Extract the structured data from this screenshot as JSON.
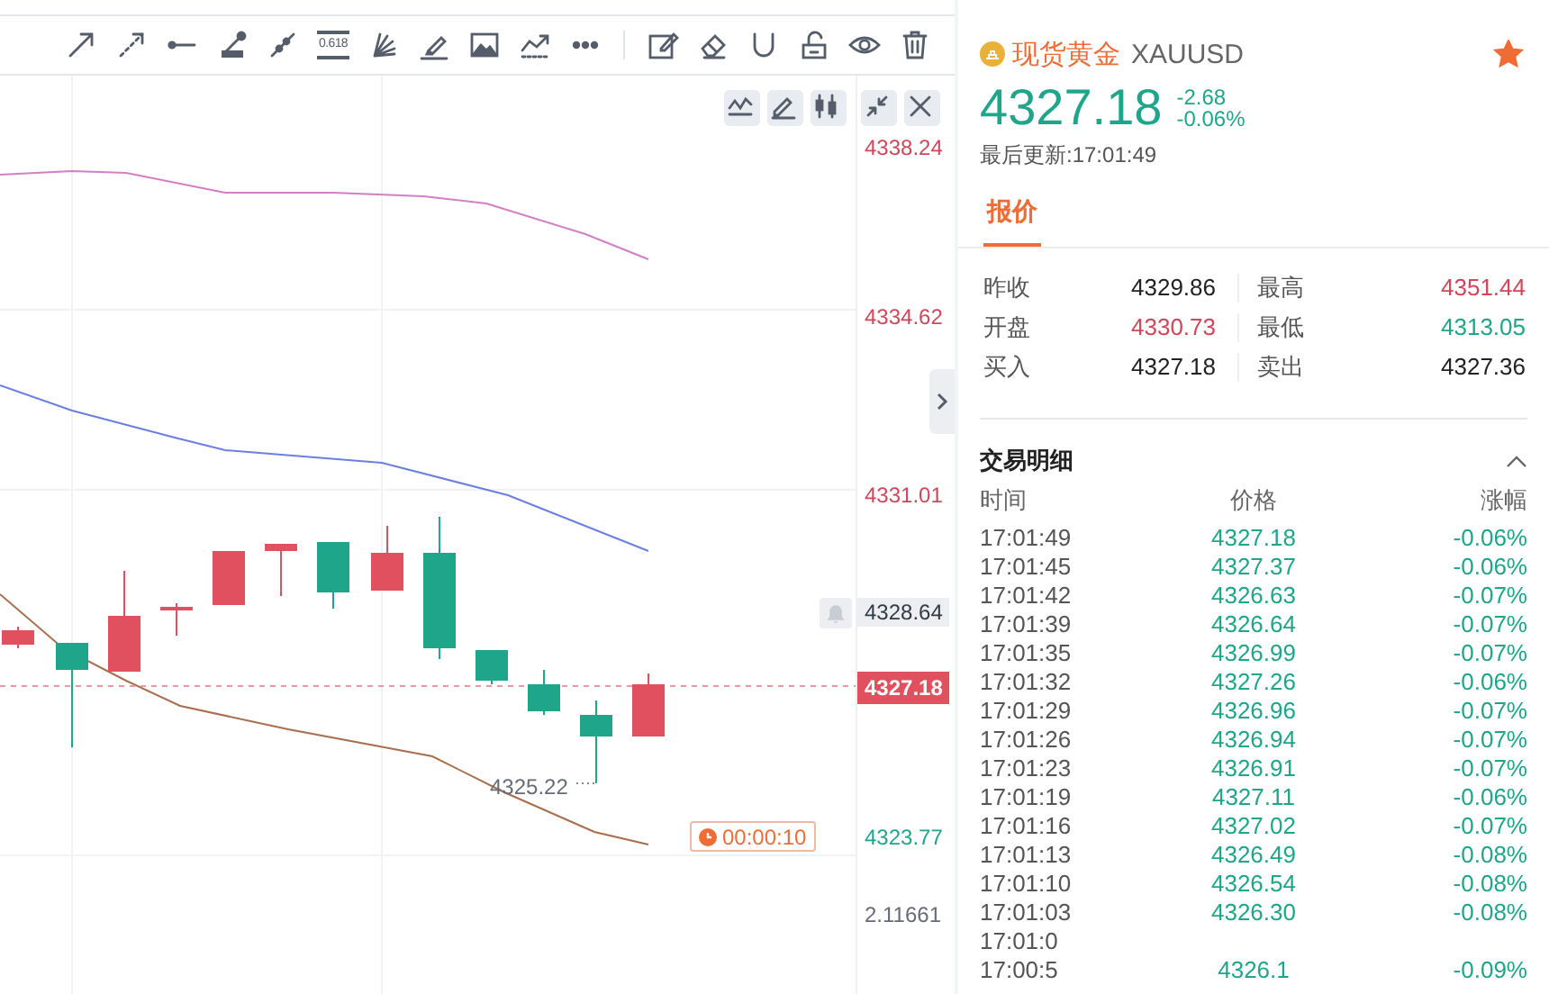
{
  "toolbar": {
    "fib_label": "0.618"
  },
  "chart": {
    "low_label": "4325.22",
    "timer": "00:00:10",
    "axis_labels": [
      {
        "text": "4338.24",
        "kind": "tick",
        "color": "#d0465a"
      },
      {
        "text": "4334.62",
        "kind": "tick",
        "color": "#d0465a"
      },
      {
        "text": "4331.01",
        "kind": "tick",
        "color": "#d0465a"
      },
      {
        "text": "4328.64",
        "kind": "marker",
        "color": "#333a44"
      },
      {
        "text": "4327.18",
        "kind": "current",
        "color": "#e0505e"
      },
      {
        "text": "4323.77",
        "kind": "tick",
        "color": "#1fa58a"
      },
      {
        "text": "2.11661",
        "kind": "tick",
        "color": "#666c75"
      }
    ]
  },
  "quote": {
    "name": "现货黄金",
    "symbol": "XAUUSD",
    "favorite": true,
    "price": "4327.18",
    "change": "-2.68",
    "change_pct": "-0.06%",
    "updated": "最后更新:17:01:49"
  },
  "tabs": [
    {
      "label": "报价",
      "selected": true
    }
  ],
  "stats": [
    {
      "label": "昨收",
      "value": "4329.86",
      "color": "#222222"
    },
    {
      "label": "最高",
      "value": "4351.44",
      "color": "#d0465a"
    },
    {
      "label": "开盘",
      "value": "4330.73",
      "color": "#d0465a"
    },
    {
      "label": "最低",
      "value": "4313.05",
      "color": "#1fa58a"
    },
    {
      "label": "买入",
      "value": "4327.18",
      "color": "#222222"
    },
    {
      "label": "卖出",
      "value": "4327.36",
      "color": "#222222"
    }
  ],
  "trades": {
    "title": "交易明细",
    "expanded": true,
    "columns": [
      "时间",
      "价格",
      "涨幅"
    ],
    "rows": [
      {
        "time": "17:01:49",
        "price": "4327.18",
        "change": "-0.06%"
      },
      {
        "time": "17:01:45",
        "price": "4327.37",
        "change": "-0.06%"
      },
      {
        "time": "17:01:42",
        "price": "4326.63",
        "change": "-0.07%"
      },
      {
        "time": "17:01:39",
        "price": "4326.64",
        "change": "-0.07%"
      },
      {
        "time": "17:01:35",
        "price": "4326.99",
        "change": "-0.07%"
      },
      {
        "time": "17:01:32",
        "price": "4327.26",
        "change": "-0.06%"
      },
      {
        "time": "17:01:29",
        "price": "4326.96",
        "change": "-0.07%"
      },
      {
        "time": "17:01:26",
        "price": "4326.94",
        "change": "-0.07%"
      },
      {
        "time": "17:01:23",
        "price": "4326.91",
        "change": "-0.07%"
      },
      {
        "time": "17:01:19",
        "price": "4327.11",
        "change": "-0.06%"
      },
      {
        "time": "17:01:16",
        "price": "4327.02",
        "change": "-0.07%"
      },
      {
        "time": "17:01:13",
        "price": "4326.49",
        "change": "-0.08%"
      },
      {
        "time": "17:01:10",
        "price": "4326.54",
        "change": "-0.08%"
      },
      {
        "time": "17:01:03",
        "price": "4326.30",
        "change": "-0.08%"
      },
      {
        "time": "17:01:0"
      },
      {
        "time": "17:00:5",
        "price": "4326.1",
        "change": "-0.09%"
      }
    ]
  }
}
